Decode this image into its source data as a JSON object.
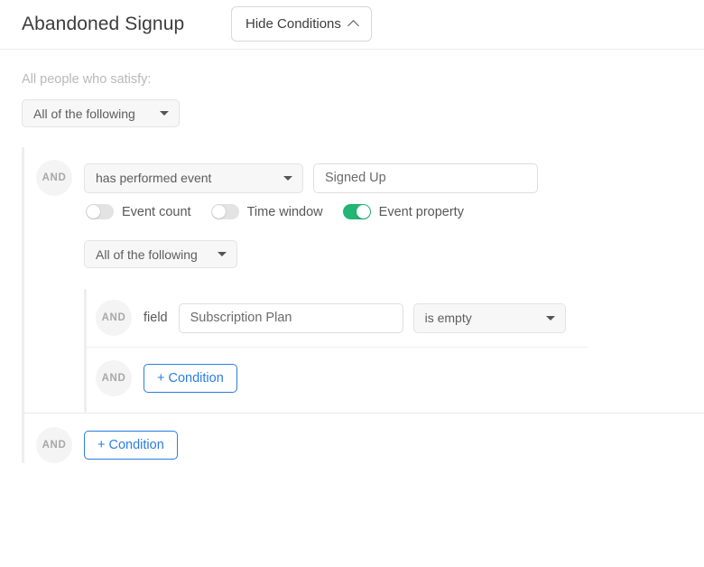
{
  "header": {
    "title": "Abandoned Signup",
    "hide_conditions_label": "Hide Conditions",
    "chevron_icon": "chevron-up-icon"
  },
  "segment_builder": {
    "satisfy_label": "All people who satisfy:",
    "root_match": {
      "value": "All of the following",
      "arrow_icon": "chevron-down-icon"
    },
    "conditions": [
      {
        "connector": "AND",
        "event_select": {
          "value": "has performed event",
          "arrow_icon": "chevron-down-icon"
        },
        "event_name": {
          "value": "Signed Up",
          "placeholder": "Event name"
        },
        "toggles": [
          {
            "label": "Event count",
            "state": "off"
          },
          {
            "label": "Time window",
            "state": "off"
          },
          {
            "label": "Event property",
            "state": "on"
          }
        ],
        "nested_match": {
          "value": "All of the following",
          "arrow_icon": "chevron-down-icon"
        },
        "nested_conditions": [
          {
            "connector": "AND",
            "field_label": "field",
            "field_name": {
              "value": "Subscription Plan",
              "placeholder": "Property name"
            },
            "operator": {
              "value": "is empty",
              "arrow_icon": "chevron-down-icon"
            }
          }
        ],
        "nested_add_condition_label": "+ Condition"
      }
    ],
    "add_condition_label": "+ Condition",
    "bottom_connector": "AND"
  },
  "colors": {
    "accent_blue": "#2b7de1",
    "toggle_on_green": "#22b573",
    "rail_gray": "#eeeeee",
    "badge_gray": "#f4f4f4"
  }
}
